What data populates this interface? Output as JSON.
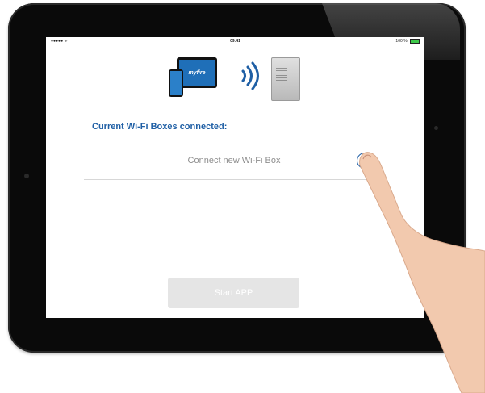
{
  "status_bar": {
    "signal": "●●●●● ᯤ",
    "time": "09:41",
    "battery": "100 %"
  },
  "hero": {
    "app_logo": "myfire"
  },
  "main": {
    "section_heading": "Current Wi-Fi Boxes connected:",
    "connect_row_label": "Connect new Wi-Fi Box",
    "add_symbol": "+",
    "start_button_label": "Start APP"
  },
  "colors": {
    "accent_blue": "#1f5fa5",
    "button_disabled": "#e5e5e5",
    "text_muted": "#8e8e8e",
    "device_frame": "#0a0a0a"
  },
  "icons": [
    "wifi-signal-icon",
    "add-circle-icon",
    "battery-icon"
  ]
}
